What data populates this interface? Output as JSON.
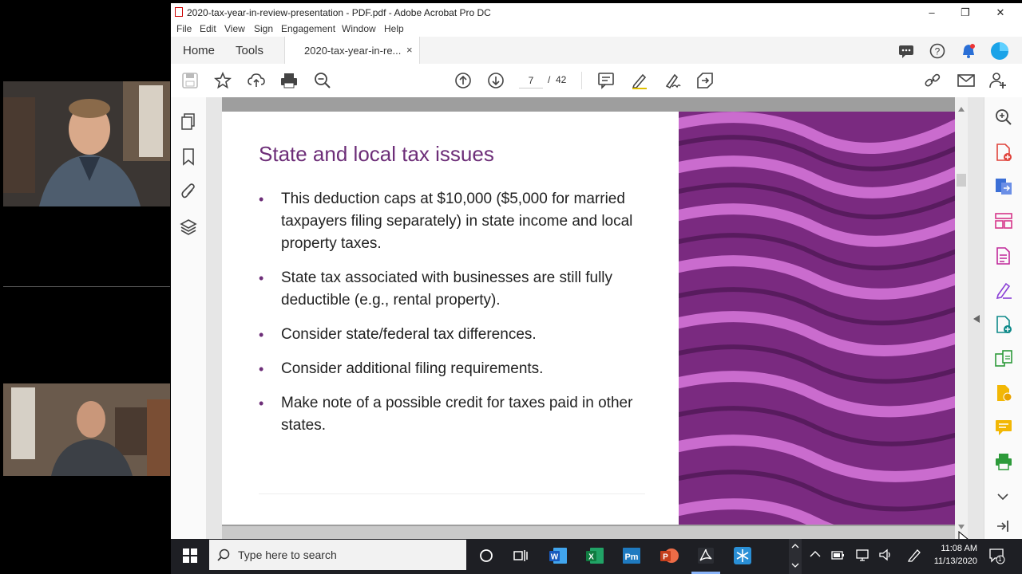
{
  "window": {
    "title": "2020-tax-year-in-review-presentation - PDF.pdf - Adobe Acrobat Pro DC"
  },
  "menu": [
    "File",
    "Edit",
    "View",
    "Sign",
    "Engagement",
    "Window",
    "Help"
  ],
  "tabs": {
    "home": "Home",
    "tools": "Tools",
    "document": "2020-tax-year-in-re...",
    "close": "×"
  },
  "toolbar": {
    "page_current": "7",
    "page_separator": "/",
    "page_total": "42"
  },
  "slide": {
    "title": "State and local tax issues",
    "bullets": [
      "This deduction caps at $10,000 ($5,000 for married taxpayers filing separately) in state income and local property taxes.",
      "State tax associated with businesses are still fully deductible (e.g., rental property).",
      "Consider state/federal tax differences.",
      "Consider additional filing requirements.",
      "Make note of a possible credit for taxes paid in other states."
    ]
  },
  "taskbar": {
    "search_placeholder": "Type here to search",
    "time": "11:08 AM",
    "date": "11/13/2020",
    "notification_count": "1"
  },
  "colors": {
    "slide_accent": "#6d2e78",
    "photo_tint": "#b04aba"
  }
}
